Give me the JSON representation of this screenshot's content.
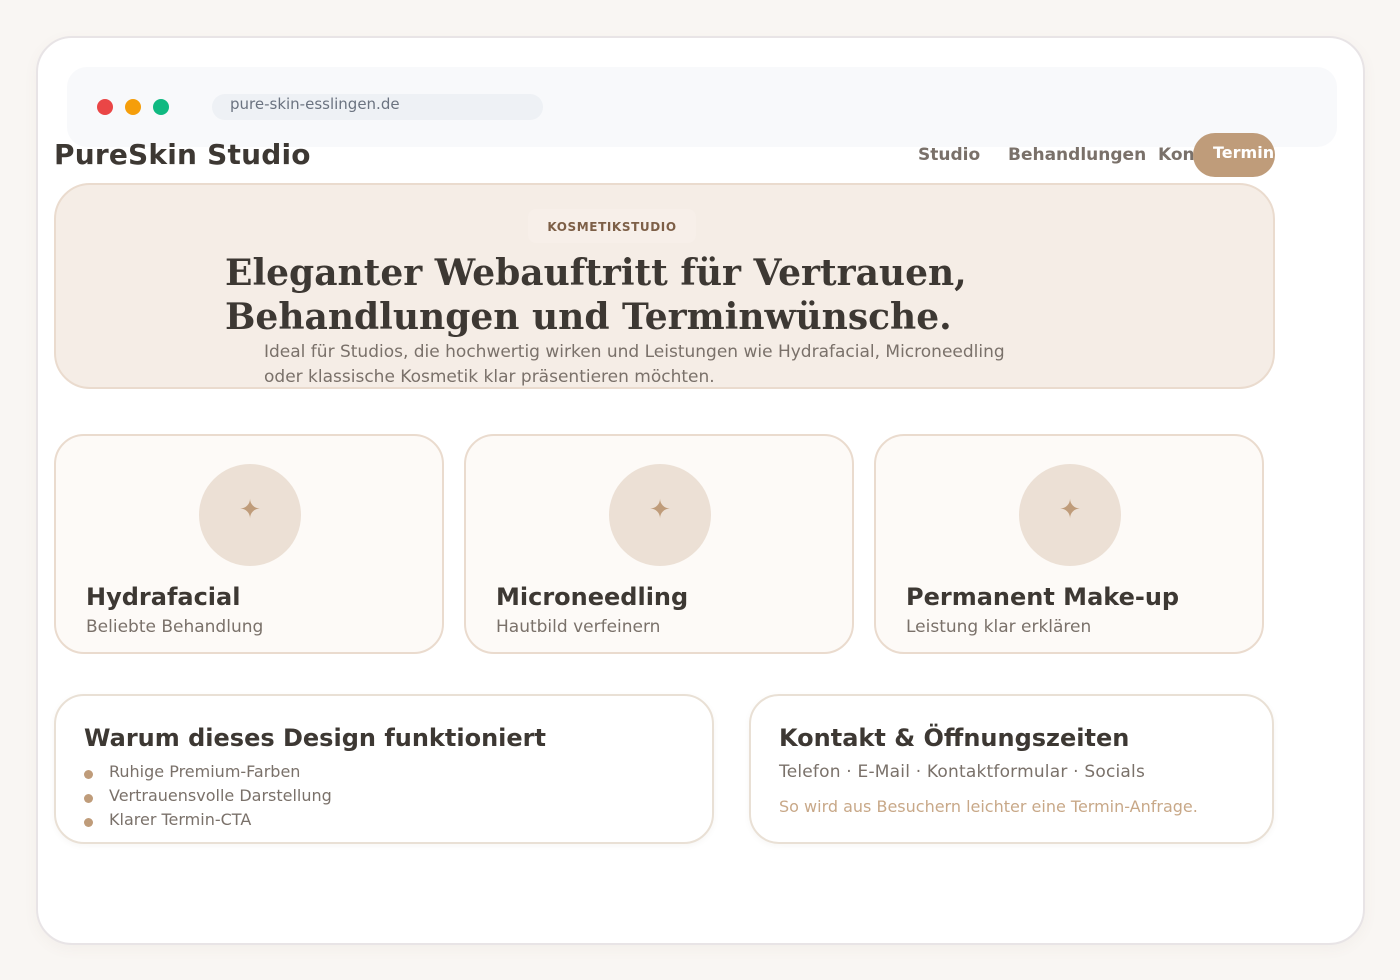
{
  "browser": {
    "url": "pure-skin-esslingen.de"
  },
  "header": {
    "brand": "PureSkin Studio",
    "nav": [
      "Studio",
      "Behandlungen",
      "Kon"
    ],
    "cta_label": "Termin"
  },
  "hero": {
    "eyebrow": "KOSMETIKSTUDIO",
    "title_line1": "Eleganter Webauftritt für Vertrauen,",
    "title_line2": "Behandlungen und Terminwünsche.",
    "subtitle_line1": "Ideal für Studios, die hochwertig wirken und Leistungen wie Hydrafacial, Microneedling",
    "subtitle_line2": "oder klassische Kosmetik klar präsentieren möchten."
  },
  "services": [
    {
      "icon": "sparkle-icon",
      "glyph": "✦",
      "title": "Hydrafacial",
      "subtitle": "Beliebte Behandlung"
    },
    {
      "icon": "sparkle-icon",
      "glyph": "✦",
      "title": "Microneedling",
      "subtitle": "Hautbild verfeinern"
    },
    {
      "icon": "sparkle-icon",
      "glyph": "✦",
      "title": "Permanent Make-up",
      "subtitle": "Leistung klar erklären"
    }
  ],
  "why": {
    "title": "Warum dieses Design funktioniert",
    "items": [
      "Ruhige Premium-Farben",
      "Vertrauensvolle Darstellung",
      "Klarer Termin-CTA"
    ]
  },
  "contact": {
    "title": "Kontakt & Öffnungszeiten",
    "line": "Telefon · E-Mail · Kontaktformular · Socials",
    "note": "So wird aus Besuchern leichter eine Termin-Anfrage."
  },
  "colors": {
    "accent": "#bf9c7a",
    "hero_bg": "#f5ede6",
    "text": "#3d3833",
    "muted": "#7a716a"
  }
}
